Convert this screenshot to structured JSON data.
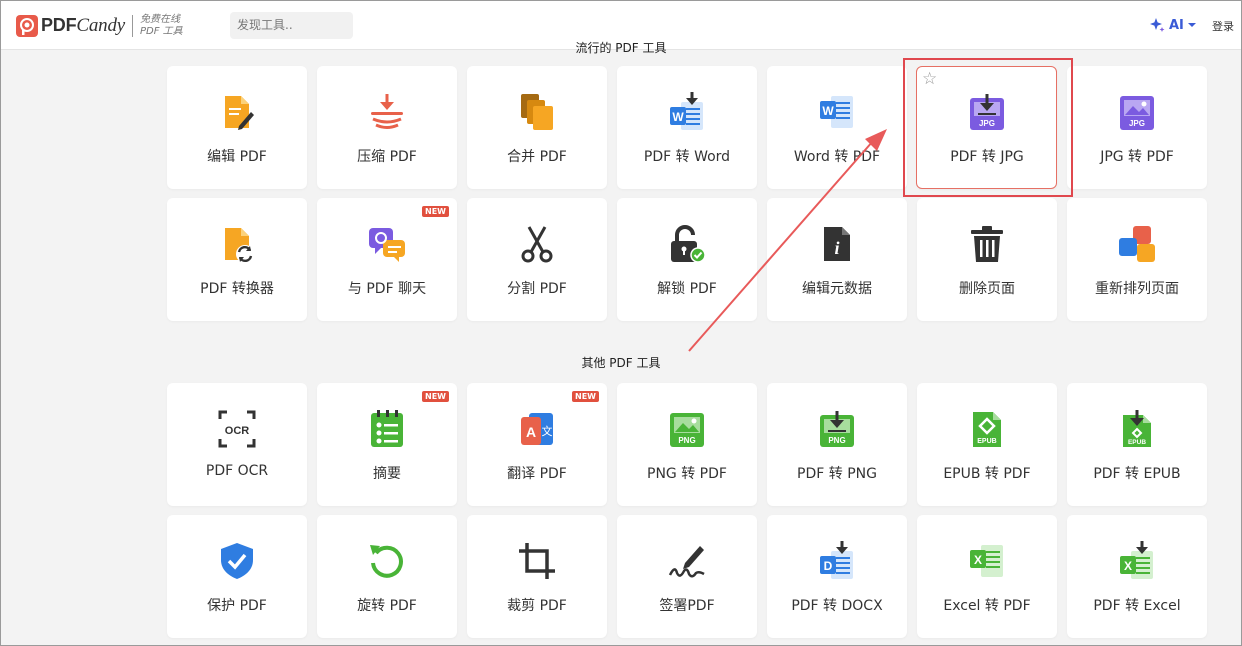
{
  "header": {
    "brand": "PDFCandy",
    "brand_pdf": "PDF",
    "brand_candy": "Candy",
    "tagline_line1": "免费在线",
    "tagline_line2": "PDF 工具",
    "search_placeholder": "发现工具..",
    "ai_label": "AI",
    "login_label": "登录"
  },
  "sections": {
    "popular_title": "流行的 PDF 工具",
    "other_title": "其他 PDF 工具"
  },
  "tools": [
    {
      "label": "编辑 PDF",
      "icon": "edit-pdf-icon"
    },
    {
      "label": "压缩 PDF",
      "icon": "compress-pdf-icon"
    },
    {
      "label": "合并 PDF",
      "icon": "merge-pdf-icon"
    },
    {
      "label": "PDF 转 Word",
      "icon": "pdf-to-word-icon"
    },
    {
      "label": "Word 转 PDF",
      "icon": "word-to-pdf-icon"
    },
    {
      "label": "PDF 转 JPG",
      "icon": "pdf-to-jpg-icon",
      "highlighted": true
    },
    {
      "label": "JPG 转 PDF",
      "icon": "jpg-to-pdf-icon"
    },
    {
      "label": "PDF 转换器",
      "icon": "pdf-converter-icon"
    },
    {
      "label": "与 PDF 聊天",
      "icon": "chat-pdf-icon",
      "badge": "NEW"
    },
    {
      "label": "分割 PDF",
      "icon": "scissors-icon"
    },
    {
      "label": "解锁 PDF",
      "icon": "unlock-icon"
    },
    {
      "label": "编辑元数据",
      "icon": "metadata-icon"
    },
    {
      "label": "删除页面",
      "icon": "trash-icon"
    },
    {
      "label": "重新排列页面",
      "icon": "rearrange-icon"
    },
    {
      "label": "PDF OCR",
      "icon": "ocr-icon"
    },
    {
      "label": "摘要",
      "icon": "summary-icon",
      "badge": "NEW"
    },
    {
      "label": "翻译 PDF",
      "icon": "translate-icon",
      "badge": "NEW"
    },
    {
      "label": "PNG 转 PDF",
      "icon": "png-to-pdf-icon"
    },
    {
      "label": "PDF 转 PNG",
      "icon": "pdf-to-png-icon"
    },
    {
      "label": "EPUB 转 PDF",
      "icon": "epub-to-pdf-icon"
    },
    {
      "label": "PDF 转 EPUB",
      "icon": "pdf-to-epub-icon"
    },
    {
      "label": "保护 PDF",
      "icon": "shield-icon"
    },
    {
      "label": "旋转 PDF",
      "icon": "rotate-icon"
    },
    {
      "label": "裁剪 PDF",
      "icon": "crop-icon"
    },
    {
      "label": "签署PDF",
      "icon": "sign-icon"
    },
    {
      "label": "PDF 转 DOCX",
      "icon": "pdf-to-docx-icon"
    },
    {
      "label": "Excel 转 PDF",
      "icon": "excel-to-pdf-icon"
    },
    {
      "label": "PDF 转 Excel",
      "icon": "pdf-to-excel-icon"
    }
  ],
  "icon_texts": {
    "jpg": "JPG",
    "png": "PNG",
    "epub": "EPUB",
    "ocr": "OCR",
    "w": "W",
    "d": "D",
    "x": "X",
    "i": "i",
    "a": "A",
    "wen": "文"
  },
  "colors": {
    "highlight": "#e0484e",
    "badge": "#e1503e",
    "arrow": "#e85a5a",
    "word_blue": "#2f7de1",
    "jpg_purple": "#7b5be0",
    "green": "#49b437"
  }
}
